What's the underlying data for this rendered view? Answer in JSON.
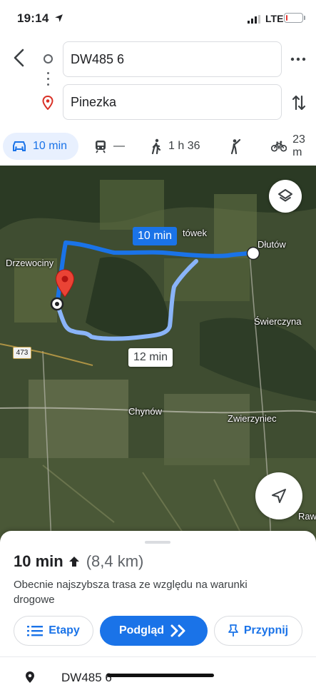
{
  "status": {
    "time": "19:14",
    "network": "LTE",
    "battery_level": 0.1
  },
  "search": {
    "origin_value": "DW485 6",
    "destination_value": "Pinezka"
  },
  "modes": [
    {
      "name": "car",
      "label": "10 min",
      "active": true
    },
    {
      "name": "transit",
      "label": "—"
    },
    {
      "name": "walk",
      "label": "1 h 36"
    },
    {
      "name": "ride",
      "label": ""
    },
    {
      "name": "bike",
      "label": "23 m"
    }
  ],
  "map": {
    "places": {
      "drzewociny": "Drzewociny",
      "dlutow": "Dłutów",
      "tower": "tówek",
      "swierczyna": "Świerczyna",
      "chynow": "Chynów",
      "zwierzyniec": "Zwierzyniec",
      "raw": "Raw"
    },
    "road_number": "473",
    "primary_route_time": "10 min",
    "alt_route_time": "12 min",
    "route_color": "#1a73e8",
    "alt_route_color": "#8ab4f8"
  },
  "sheet": {
    "duration": "10 min",
    "distance": "(8,4 km)",
    "description": "Obecnie najszybsza trasa ze względu na warunki drogowe",
    "steps_label": "Etapy",
    "preview_label": "Podgląd",
    "pin_label": "Przypnij",
    "first_step": "DW485 6"
  },
  "colors": {
    "accent": "#1a73e8",
    "pin": "#ea4335"
  }
}
